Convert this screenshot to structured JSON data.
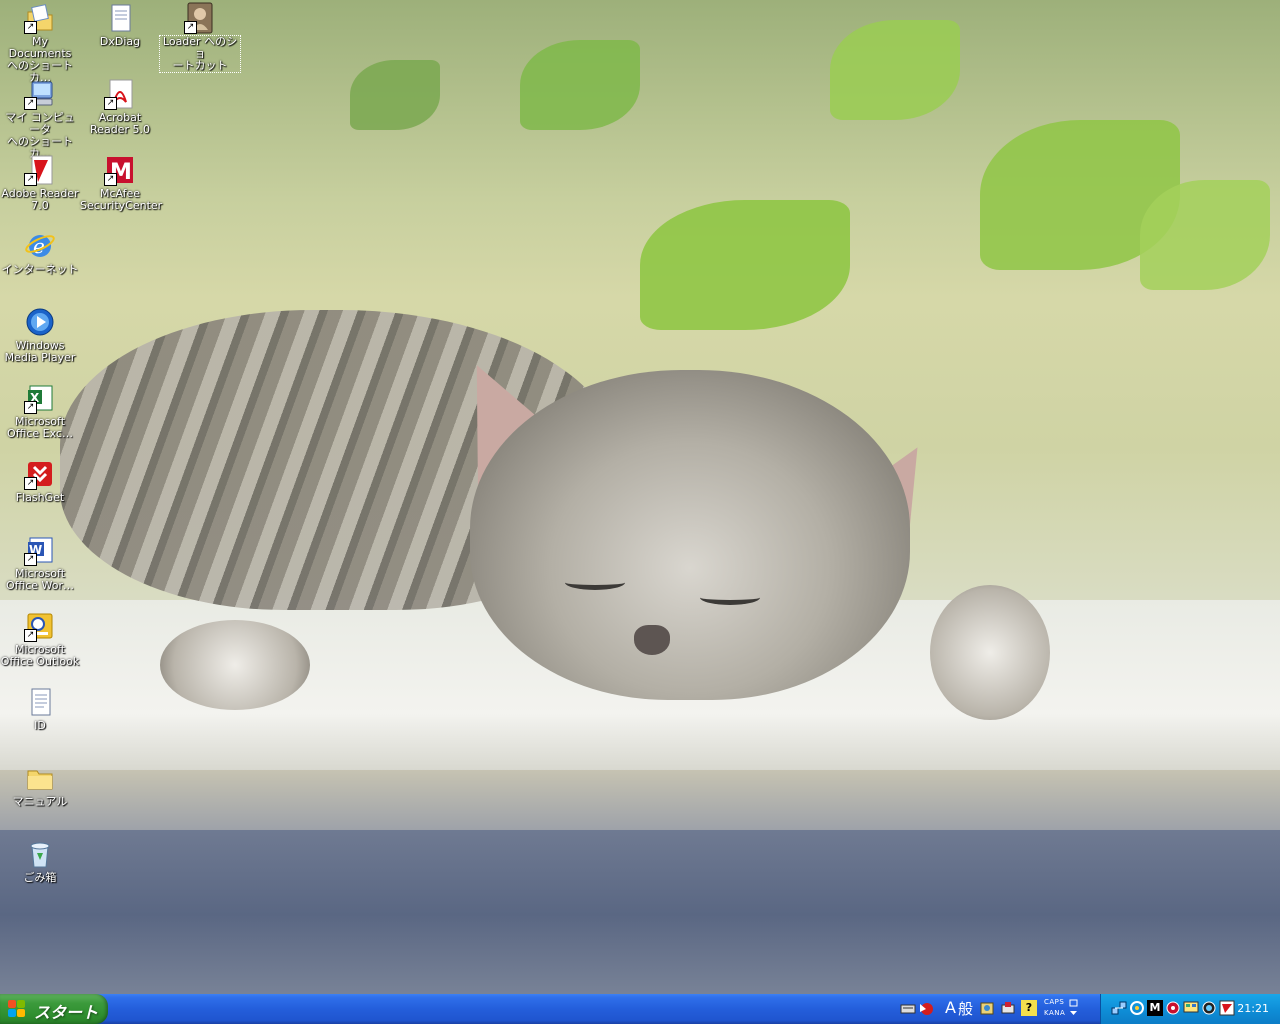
{
  "desktop": {
    "icons": [
      {
        "label": "My Documents\nへのショートカ…"
      },
      {
        "label": "DxDiag"
      },
      {
        "label": "Loader へのショ\nートカット"
      },
      {
        "label": "マイ コンピュータ\nへのショートカ…"
      },
      {
        "label": "Acrobat\nReader 5.0"
      },
      {
        "label": "Adobe Reader\n7.0"
      },
      {
        "label": "McAfee\nSecurityCenter"
      },
      {
        "label": "インターネット"
      },
      {
        "label": "Windows\nMedia Player"
      },
      {
        "label": "Microsoft\nOffice Exc…"
      },
      {
        "label": "FlashGet"
      },
      {
        "label": "Microsoft\nOffice Wor…"
      },
      {
        "label": "Microsoft\nOffice Outlook"
      },
      {
        "label": "ID"
      },
      {
        "label": "マニュアル"
      },
      {
        "label": "ごみ箱"
      }
    ]
  },
  "taskbar": {
    "start_label": "スタート",
    "ime_mode": "A",
    "ime_input": "般",
    "caps": "CAPS",
    "kana": "KANA",
    "clock": "21:21"
  },
  "colors": {
    "taskbar": "#245edb",
    "start": "#3c9a3c",
    "tray": "#0f8fd8"
  }
}
